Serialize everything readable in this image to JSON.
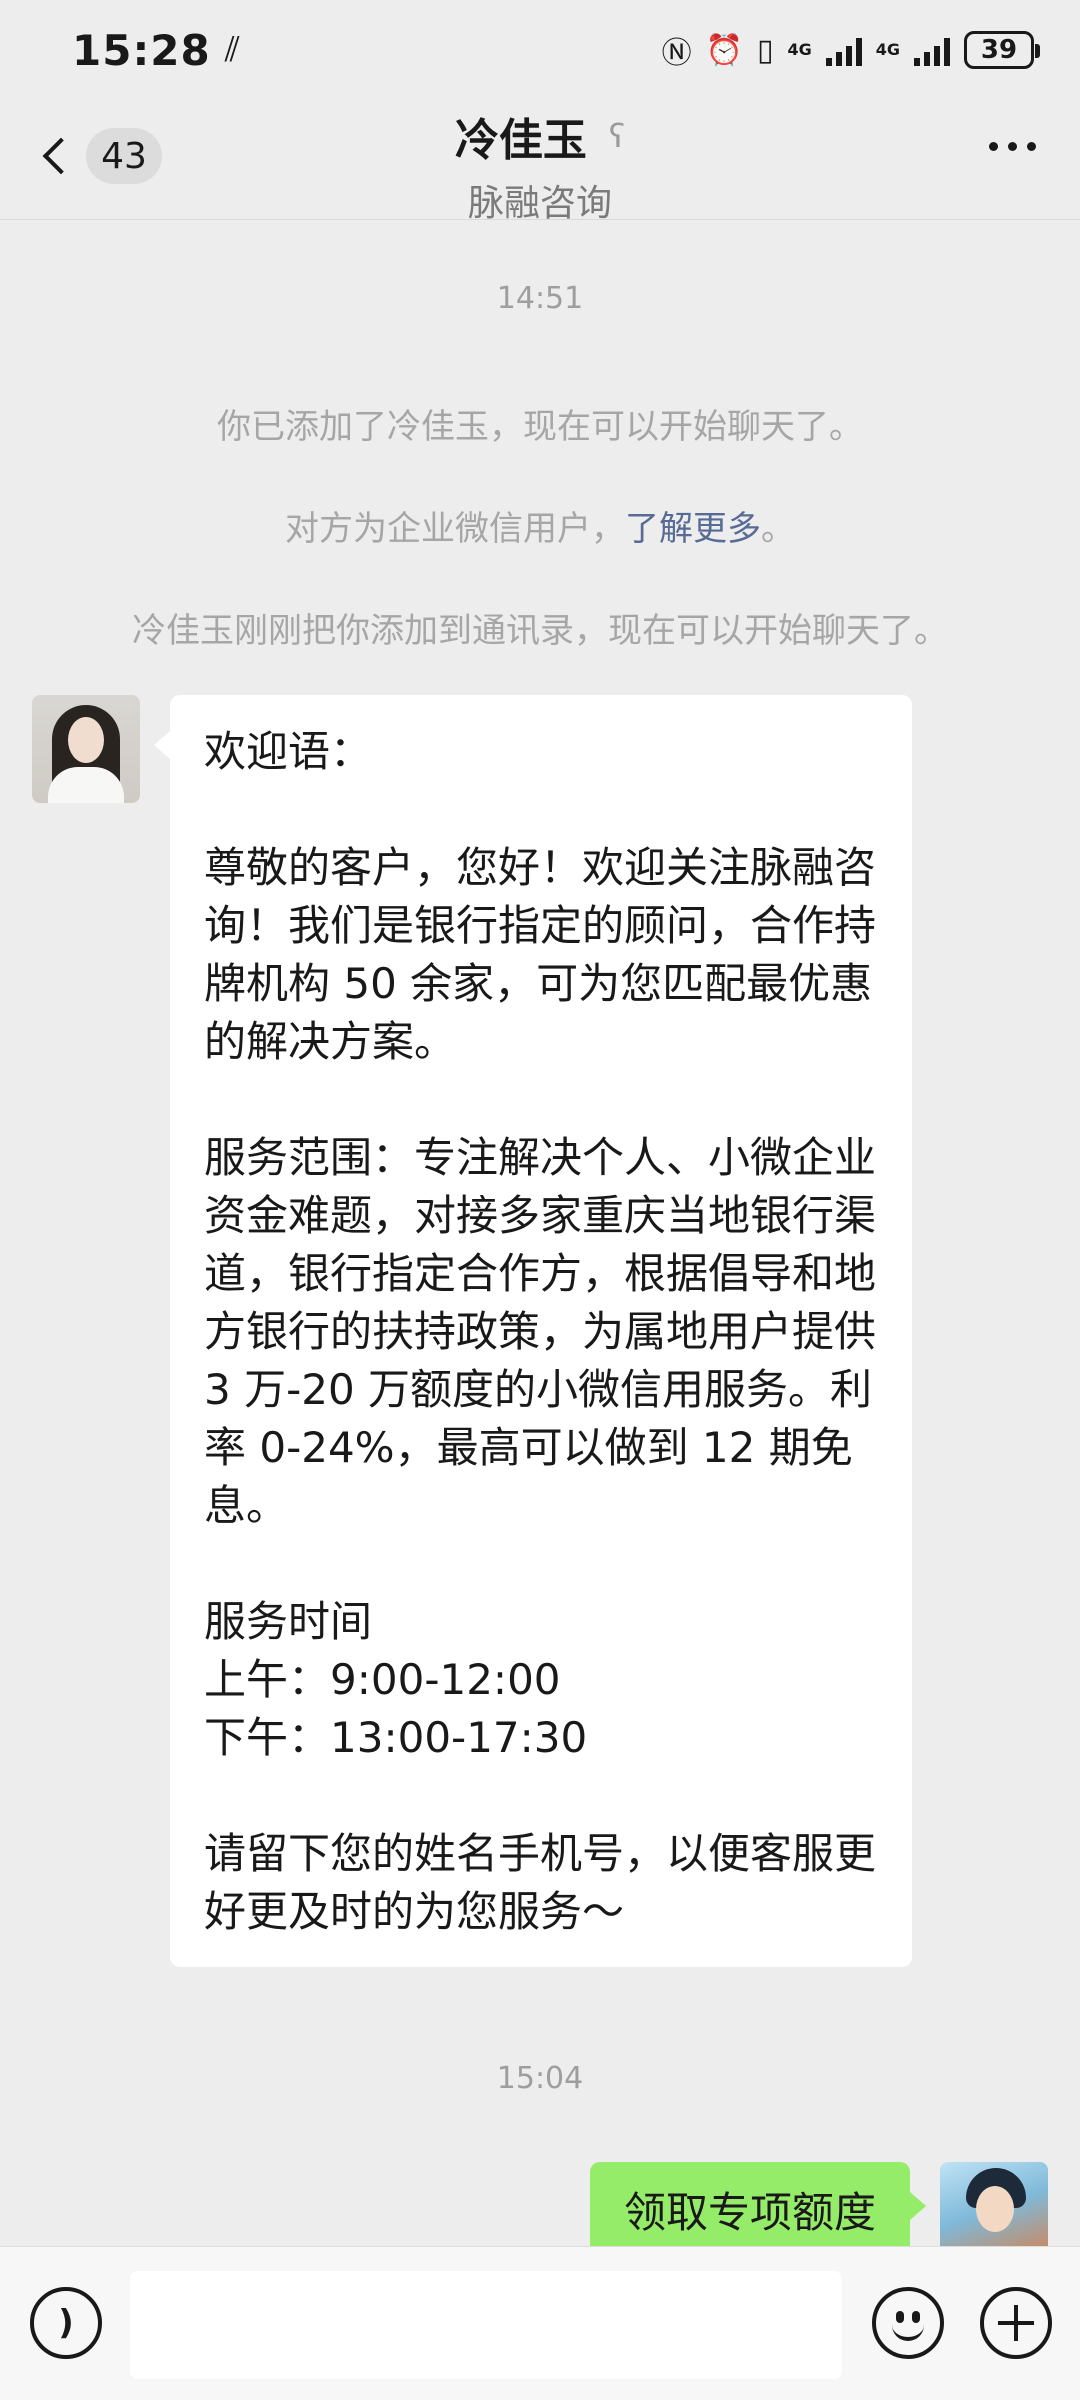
{
  "status_bar": {
    "time": "15:28",
    "network_1": "4G",
    "network_2": "4G",
    "battery": "39"
  },
  "title_bar": {
    "unread_count": "43",
    "contact_name": "冷佳玉",
    "company": "脉融咨询",
    "icons": [
      "back-icon",
      "ear-icon",
      "more-icon"
    ]
  },
  "chat": {
    "timestamp_1": "14:51",
    "system_msg_1": "你已添加了冷佳玉，现在可以开始聊天了。",
    "system_msg_2_prefix": "对方为企业微信用户，",
    "system_msg_2_link": "了解更多",
    "system_msg_2_suffix": "。",
    "system_msg_3": "冷佳玉刚刚把你添加到通讯录，现在可以开始聊天了。",
    "incoming_message": {
      "greeting": "欢迎语：",
      "intro": "尊敬的客户，您好！欢迎关注脉融咨询！我们是银行指定的顾问，合作持牌机构 50 余家，可为您匹配最优惠的解决方案。",
      "scope": "服务范围：专注解决个人、小微企业资金难题，对接多家重庆当地银行渠道，银行指定合作方，根据倡导和地方银行的扶持政策，为属地用户提供 3 万-20 万额度的小微信用服务。利率 0-24%，最高可以做到 12 期免息。",
      "hours_title": "服务时间",
      "hours_am": "上午：9:00-12:00",
      "hours_pm": "下午：13:00-17:30",
      "closing": "请留下您的姓名手机号，以便客服更好更及时的为您服务～"
    },
    "timestamp_2": "15:04",
    "outgoing_message": "领取专项额度"
  },
  "input_bar": {
    "value": "",
    "icons": [
      "voice-icon",
      "emoji-icon",
      "plus-icon"
    ]
  },
  "colors": {
    "background": "#ededed",
    "incoming_bubble": "#ffffff",
    "outgoing_bubble": "#95ec69",
    "link": "#576b95"
  }
}
